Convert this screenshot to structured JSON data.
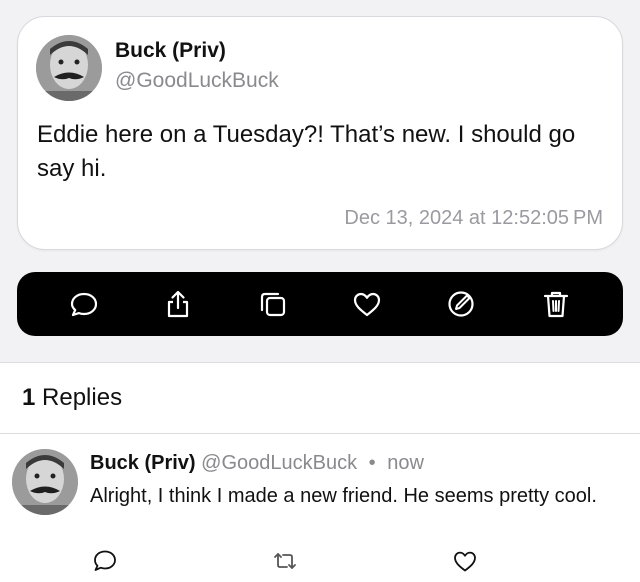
{
  "post": {
    "author_name": "Buck (Priv)",
    "author_handle": "@GoodLuckBuck",
    "text": "Eddie here on a Tuesday?! That’s new. I should go say hi.",
    "timestamp": "Dec 13, 2024 at 12:52:05 PM"
  },
  "toolbar": {
    "actions": [
      {
        "icon": "reply-icon"
      },
      {
        "icon": "share-icon"
      },
      {
        "icon": "copy-icon"
      },
      {
        "icon": "heart-icon"
      },
      {
        "icon": "edit-icon"
      },
      {
        "icon": "trash-icon"
      }
    ]
  },
  "replies": {
    "count": "1",
    "label": "Replies"
  },
  "reply": {
    "author_name": "Buck (Priv)",
    "author_handle": "@GoodLuckBuck",
    "separator": "•",
    "time": "now",
    "text": "Alright, I think I made a new friend. He seems pretty cool."
  },
  "colors": {
    "toolbar_bg": "#000000",
    "top_bg": "#f2f2f4",
    "muted_text": "#8a8a8e"
  }
}
